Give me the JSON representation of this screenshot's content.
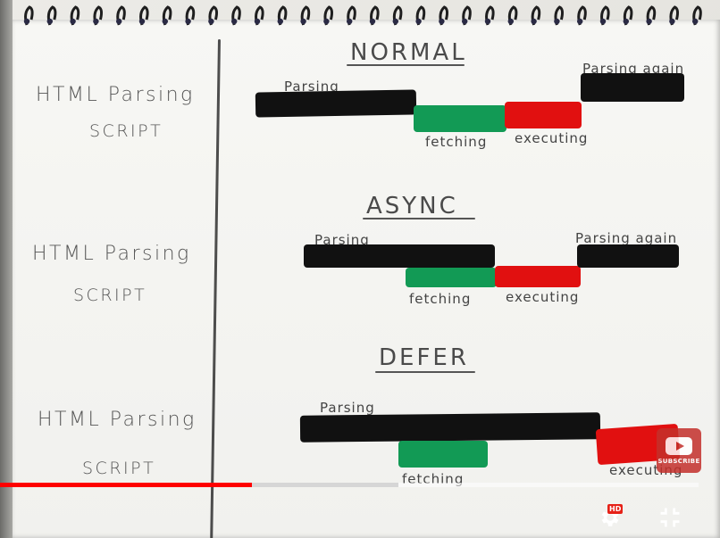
{
  "sections": [
    {
      "title": "NORMAL",
      "left_label_1": "HTML Parsing",
      "left_label_2": "SCRIPT",
      "bar_label_parsing": "Parsing",
      "bar_label_fetching": "fetching",
      "bar_label_executing": "executing",
      "bar_label_parsing_again": "Parsing again"
    },
    {
      "title": "ASYNC",
      "left_label_1": "HTML Parsing",
      "left_label_2": "SCRIPT",
      "bar_label_parsing": "Parsing",
      "bar_label_fetching": "fetching",
      "bar_label_executing": "executing",
      "bar_label_parsing_again": "Parsing again"
    },
    {
      "title": "DEFER",
      "left_label_1": "HTML Parsing",
      "left_label_2": "SCRIPT",
      "bar_label_parsing": "Parsing",
      "bar_label_fetching": "fetching",
      "bar_label_executing": "executing"
    }
  ],
  "colors": {
    "parsing": "#111111",
    "fetching": "#129a55",
    "executing": "#e11010"
  },
  "player": {
    "progress_played": 0.36,
    "progress_buffered": 0.57,
    "watermark_text": "SUBSCRIBE",
    "hd_badge": "HD",
    "icons": [
      "settings-gear-icon",
      "exit-fullscreen-icon"
    ]
  }
}
